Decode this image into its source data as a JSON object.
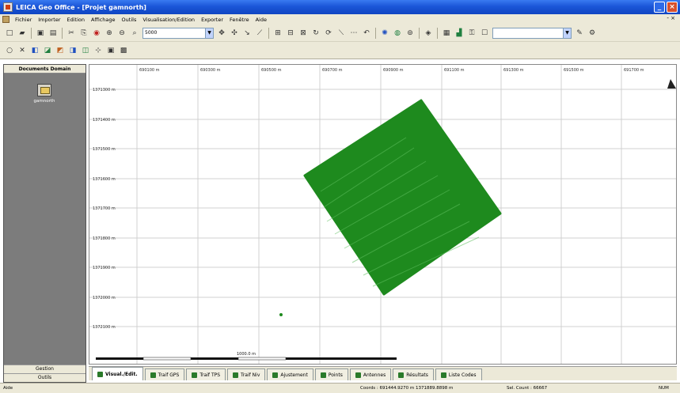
{
  "window": {
    "title": "LEICA Geo Office - [Projet gamnorth]"
  },
  "menu": {
    "items": [
      "Fichier",
      "Importer",
      "Edition",
      "Affichage",
      "Outils",
      "Visualisation/Edition",
      "Exporter",
      "Fenêtre",
      "Aide"
    ]
  },
  "toolbar": {
    "scale_value": "5000"
  },
  "left_panel": {
    "title": "Documents Domain",
    "document_label": "gamnorth",
    "tab_bottom_1": "Gestion",
    "tab_bottom_2": "Outils"
  },
  "map": {
    "x_ticks": [
      "690100 m",
      "690300 m",
      "690500 m",
      "690700 m",
      "690900 m",
      "691100 m",
      "691300 m",
      "691500 m",
      "691700 m"
    ],
    "y_ticks": [
      "1371300 m",
      "1371400 m",
      "1371500 m",
      "1371600 m",
      "1371700 m",
      "1371800 m",
      "1371900 m",
      "1372000 m",
      "1372100 m"
    ],
    "scale_bar_label": "1000.0 m",
    "track_color": "#1e8a1e",
    "north_arrow": "north-arrow-icon"
  },
  "tabs": [
    {
      "label": "Visual./Edit.",
      "icon": "map-icon",
      "active": true
    },
    {
      "label": "Traif GPS",
      "icon": "gps-icon",
      "active": false
    },
    {
      "label": "Traif TPS",
      "icon": "tps-icon",
      "active": false
    },
    {
      "label": "Traif Niv",
      "icon": "level-icon",
      "active": false
    },
    {
      "label": "Ajustement",
      "icon": "adjust-icon",
      "active": false
    },
    {
      "label": "Points",
      "icon": "points-icon",
      "active": false
    },
    {
      "label": "Antennes",
      "icon": "antenna-icon",
      "active": false
    },
    {
      "label": "Résultats",
      "icon": "results-icon",
      "active": false
    },
    {
      "label": "Liste Codes",
      "icon": "codes-icon",
      "active": false
    }
  ],
  "status": {
    "left": "Aide",
    "coords": "Coords : 691444.9270 m  1371889.8898 m",
    "count": "Sel. Count : 66667",
    "right": "NUM"
  }
}
